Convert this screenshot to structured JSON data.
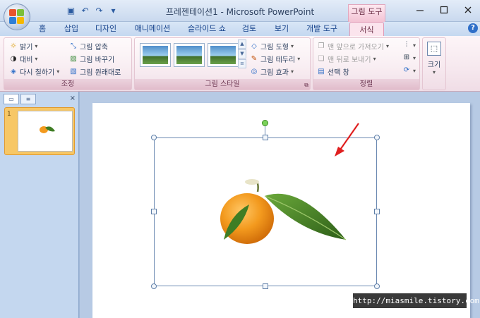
{
  "window": {
    "title": "프레젠테이션1 - Microsoft PowerPoint",
    "context_tab": "그림 도구"
  },
  "qat": {
    "save": "save-icon",
    "undo": "undo-icon",
    "redo": "redo-icon",
    "customize": "▾"
  },
  "tabs": [
    {
      "label": "홈"
    },
    {
      "label": "삽입"
    },
    {
      "label": "디자인"
    },
    {
      "label": "애니메이션"
    },
    {
      "label": "슬라이드 쇼"
    },
    {
      "label": "검토"
    },
    {
      "label": "보기"
    },
    {
      "label": "개발 도구"
    },
    {
      "label": "서식"
    }
  ],
  "ribbon": {
    "adjust": {
      "label": "조정",
      "brightness": "밝기",
      "contrast": "대비",
      "recolor": "다시 칠하기",
      "compress": "그림 압축",
      "change": "그림 바꾸기",
      "reset": "그림 원래대로"
    },
    "styles": {
      "label": "그림 스타일",
      "shape": "그림 도형",
      "border": "그림 테두리",
      "effects": "그림 효과"
    },
    "arrange": {
      "label": "정렬",
      "bring_front": "맨 앞으로 가져오기",
      "send_back": "맨 뒤로 보내기",
      "selection_pane": "선택 창"
    },
    "size": {
      "label": "크기"
    }
  },
  "slides_pane": {
    "slide_number": "1"
  },
  "watermark": "http://miasmile.tistory.com",
  "colors": {
    "accent_context": "#f3c3d4",
    "ribbon_blue": "#c4d8f0",
    "selection": "#6c8ab2",
    "arrow": "#e02020"
  }
}
